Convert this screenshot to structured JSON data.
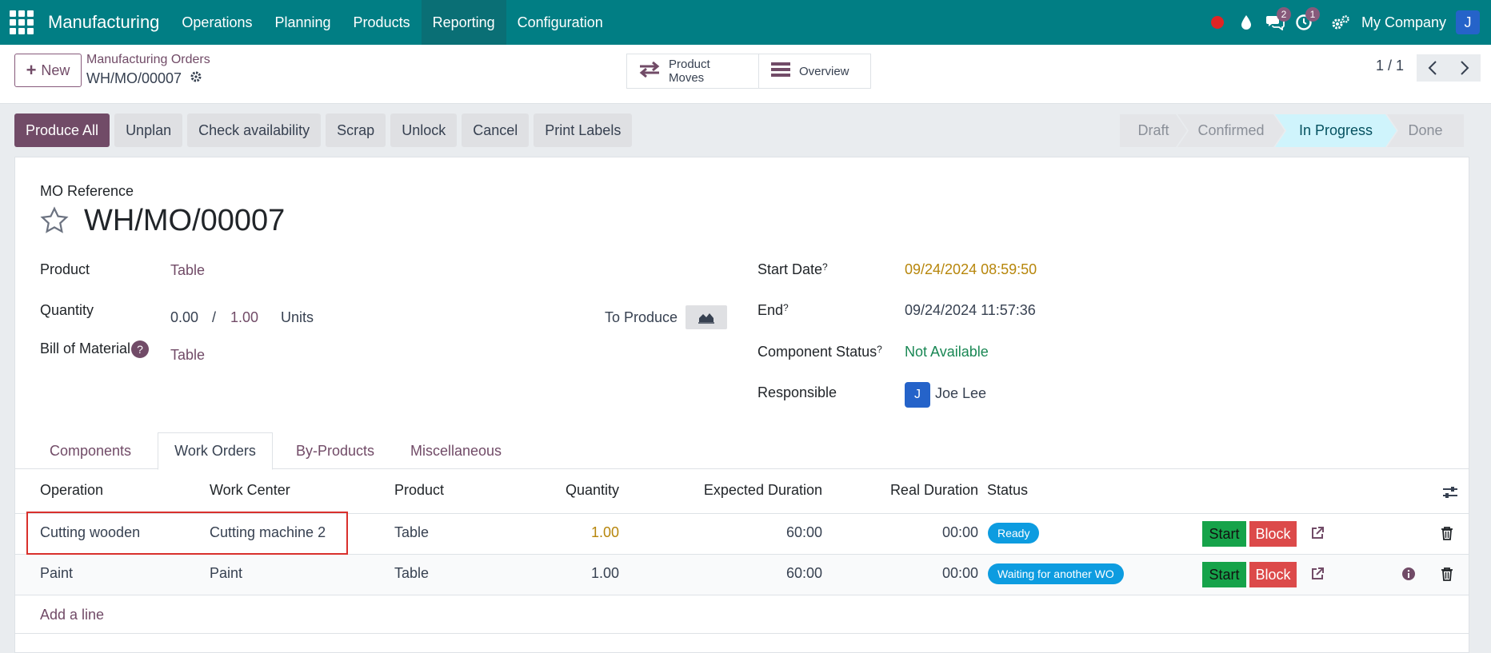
{
  "nav": {
    "app_name": "Manufacturing",
    "menu": [
      "Operations",
      "Planning",
      "Products",
      "Reporting",
      "Configuration"
    ],
    "active_menu": "Reporting",
    "chat_count": "2",
    "activity_count": "1",
    "company": "My Company",
    "user_initial": "J"
  },
  "control": {
    "new_label": "New",
    "breadcrumb_parent": "Manufacturing Orders",
    "breadcrumb_current": "WH/MO/00007",
    "smart_buttons": [
      "Product Moves",
      "Overview"
    ],
    "pager": "1 / 1"
  },
  "actions": [
    "Produce All",
    "Unplan",
    "Check availability",
    "Scrap",
    "Unlock",
    "Cancel",
    "Print Labels"
  ],
  "stages": [
    "Draft",
    "Confirmed",
    "In Progress",
    "Done"
  ],
  "current_stage": "In Progress",
  "form": {
    "ref_label": "MO Reference",
    "ref": "WH/MO/00007",
    "product_label": "Product",
    "product": "Table",
    "quantity_label": "Quantity",
    "qty_produced": "0.00",
    "qty_sep": "/",
    "qty_total": "1.00",
    "qty_uom": "Units",
    "to_produce_label": "To Produce",
    "bom_label": "Bill of Material",
    "bom_help": "?",
    "bom": "Table",
    "start_label": "Start Date",
    "start": "09/24/2024 08:59:50",
    "end_label": "End",
    "end": "09/24/2024 11:57:36",
    "component_status_label": "Component Status",
    "component_status": "Not Available",
    "responsible_label": "Responsible",
    "responsible_initial": "J",
    "responsible": "Joe Lee",
    "help_mark": "?"
  },
  "tabs": [
    "Components",
    "Work Orders",
    "By-Products",
    "Miscellaneous"
  ],
  "active_tab": "Work Orders",
  "table": {
    "columns": [
      "Operation",
      "Work Center",
      "Product",
      "Quantity",
      "Expected Duration",
      "Real Duration",
      "Status"
    ],
    "rows": [
      {
        "operation": "Cutting wooden",
        "work_center": "Cutting machine 2",
        "product": "Table",
        "quantity": "1.00",
        "expected": "60:00",
        "real": "00:00",
        "status": "Ready",
        "start": "Start",
        "block": "Block"
      },
      {
        "operation": "Paint",
        "work_center": "Paint",
        "product": "Table",
        "quantity": "1.00",
        "expected": "60:00",
        "real": "00:00",
        "status": "Waiting for another WO",
        "start": "Start",
        "block": "Block"
      }
    ],
    "add_line": "Add a line"
  },
  "colors": {
    "navbar": "#017e84",
    "brand": "#714b67",
    "start_green": "#16a34a",
    "block_red": "#dc4a4a",
    "status_blue": "#0d9ce0",
    "date_amber": "#b7860b",
    "available_green": "#198754"
  }
}
